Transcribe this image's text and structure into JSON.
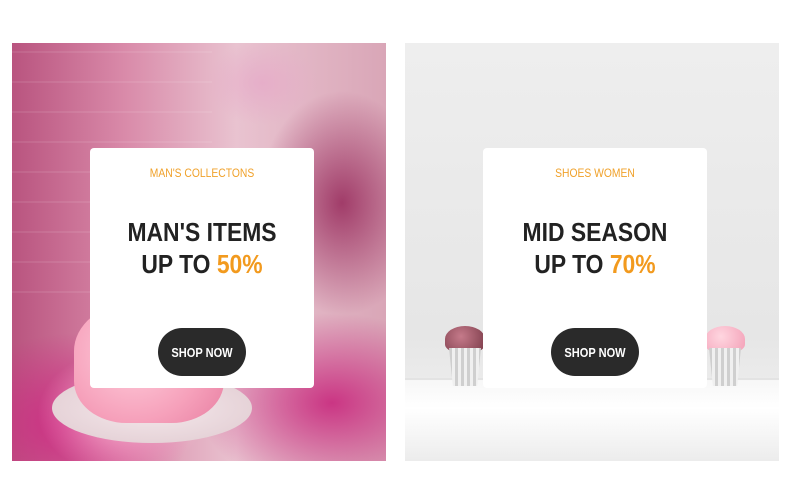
{
  "banners": [
    {
      "eyebrow": "MAN'S COLLECTONS",
      "headline_line1": "MAN'S ITEMS",
      "headline_prefix": "UP TO ",
      "headline_percent": "50%",
      "button_label": "SHOP NOW"
    },
    {
      "eyebrow": "SHOES WOMEN",
      "headline_line1": "MID SEASON",
      "headline_prefix": "UP TO ",
      "headline_percent": "70%",
      "button_label": "SHOP NOW"
    }
  ],
  "colors": {
    "accent": "#f29a1e",
    "eyebrow": "#f0a12a",
    "headline": "#222222",
    "button_bg": "#2a2a2a",
    "button_text": "#ffffff"
  }
}
